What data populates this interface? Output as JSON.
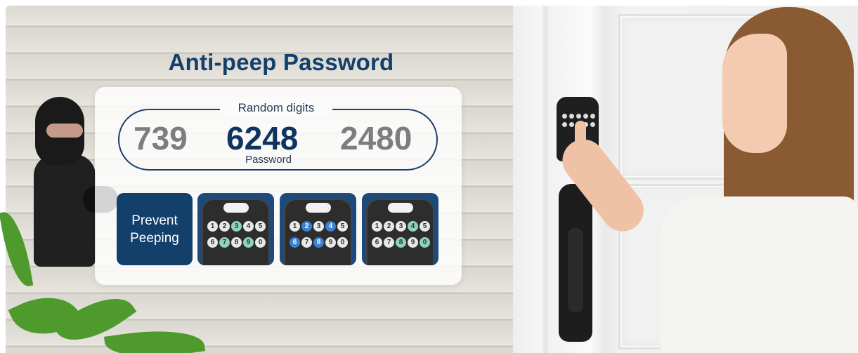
{
  "title": "Anti-peep Password",
  "random_caption": "Random digits",
  "digits": {
    "left": "739",
    "middle": "6248",
    "right": "2480"
  },
  "password_label": "Password",
  "prevent": {
    "line1": "Prevent",
    "line2": "Peeping"
  },
  "keypads": [
    {
      "keys": [
        "1",
        "2",
        "3",
        "4",
        "5",
        "6",
        "7",
        "8",
        "9",
        "0"
      ],
      "highlight": "green"
    },
    {
      "keys": [
        "1",
        "2",
        "3",
        "4",
        "5",
        "6",
        "7",
        "8",
        "9",
        "0"
      ],
      "highlight": "blue"
    },
    {
      "keys": [
        "1",
        "2",
        "3",
        "4",
        "5",
        "6",
        "7",
        "8",
        "9",
        "0"
      ],
      "highlight": "green"
    }
  ],
  "colors": {
    "brand_blue": "#133f6b",
    "digit_gray": "#7d7d7d",
    "key_green": "#8fd3b8",
    "key_blue": "#3a82d1"
  },
  "icons": [
    "lock-icon"
  ]
}
